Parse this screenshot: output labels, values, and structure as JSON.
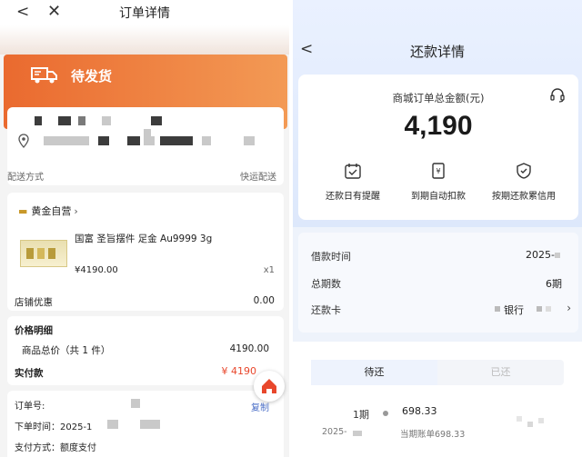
{
  "left": {
    "nav": {
      "back_icon": "chevron-left-icon",
      "close_icon": "close-icon",
      "title": "订单详情"
    },
    "status": {
      "icon": "truck-icon",
      "text": "待发货"
    },
    "shipping": {
      "label": "配送方式",
      "value": "快运配送"
    },
    "goods": {
      "shop_name": "黄金自营",
      "shop_arrow": "›",
      "product_name": "国富 圣旨摆件 足金 Au9999 3g",
      "price": "¥4190.00",
      "qty": "x1",
      "discount_label": "店铺优惠",
      "discount_value": "0.00"
    },
    "price_detail": {
      "title": "价格明细",
      "total_label": "商品总价（共 1 件）",
      "total_value": "4190.00",
      "paid_label": "实付款",
      "paid_value": "¥ 4190"
    },
    "order": {
      "no_label": "订单号:",
      "copy_label": "复制",
      "time_label": "下单时间：",
      "time_value": "2025-1",
      "pay_label": "支付方式：",
      "pay_value": "额度支付"
    },
    "accent_color": "#ea6a2f"
  },
  "right": {
    "nav": {
      "back_icon": "chevron-left-icon",
      "title": "还款详情"
    },
    "summary": {
      "label": "商城订单总金额(元)",
      "amount": "4,190",
      "support_icon": "headset-icon",
      "features": [
        {
          "icon": "calendar-check-icon",
          "label": "还款日有提醒"
        },
        {
          "icon": "yuan-card-icon",
          "label": "到期自动扣款"
        },
        {
          "icon": "shield-check-icon",
          "label": "按期还款累信用"
        }
      ]
    },
    "info": {
      "rows": [
        {
          "label": "借款时间",
          "value": "2025-"
        },
        {
          "label": "总期数",
          "value": "6期"
        },
        {
          "label": "还款卡",
          "value": "银行"
        }
      ]
    },
    "schedule": {
      "tabs": [
        {
          "label": "待还",
          "active": true
        },
        {
          "label": "已还",
          "active": false
        }
      ],
      "items": [
        {
          "period": "1期",
          "amount": "698.33",
          "date": "2025-",
          "bill": "当期账单698.33"
        }
      ]
    }
  }
}
